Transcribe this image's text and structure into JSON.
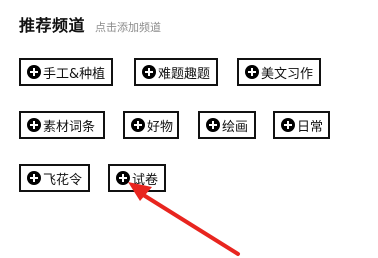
{
  "header": {
    "title": "推荐频道",
    "subtitle": "点击添加频道"
  },
  "channels": [
    {
      "label": "手工&种植"
    },
    {
      "label": "难题趣题"
    },
    {
      "label": "美文习作"
    },
    {
      "label": "素材词条"
    },
    {
      "label": "好物"
    },
    {
      "label": "绘画"
    },
    {
      "label": "日常"
    },
    {
      "label": "飞花令"
    },
    {
      "label": "试卷"
    }
  ],
  "icons": {
    "add": "plus-circle-icon"
  },
  "colors": {
    "chip_border": "#111111",
    "subtitle": "#8c8c8c",
    "annotation_arrow": "#e8251f"
  }
}
